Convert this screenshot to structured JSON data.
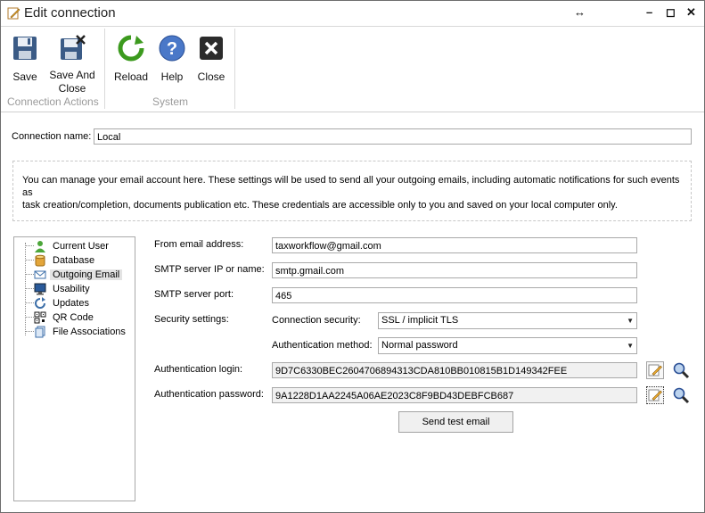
{
  "window": {
    "title": "Edit connection"
  },
  "ribbon": {
    "groups": [
      {
        "label": "Connection Actions",
        "buttons": [
          {
            "label": "Save"
          },
          {
            "label": "Save And Close"
          }
        ]
      },
      {
        "label": "System",
        "buttons": [
          {
            "label": "Reload"
          },
          {
            "label": "Help"
          },
          {
            "label": "Close"
          }
        ]
      }
    ]
  },
  "connection": {
    "name_label": "Connection name:",
    "name_value": "Local"
  },
  "info": {
    "line1": "You can manage your email account here. These settings will be used to send all your outgoing emails, including automatic notifications for such events as",
    "line2": "task creation/completion, documents publication etc. These credentials are accessible only to you and saved on your local computer only."
  },
  "nav": {
    "items": [
      {
        "label": "Current User",
        "icon": "user-icon"
      },
      {
        "label": "Database",
        "icon": "database-icon"
      },
      {
        "label": "Outgoing Email",
        "icon": "envelope-icon",
        "selected": true
      },
      {
        "label": "Usability",
        "icon": "monitor-icon"
      },
      {
        "label": "Updates",
        "icon": "refresh-icon"
      },
      {
        "label": "QR Code",
        "icon": "qr-code-icon"
      },
      {
        "label": "File Associations",
        "icon": "documents-icon"
      }
    ]
  },
  "email": {
    "from_label": "From email address:",
    "from_value": "taxworkflow@gmail.com",
    "smtp_label": "SMTP server IP or name:",
    "smtp_value": "smtp.gmail.com",
    "port_label": "SMTP server port:",
    "port_value": "465",
    "security_label": "Security settings:",
    "conn_security_label": "Connection security:",
    "conn_security_value": "SSL / implicit TLS",
    "auth_method_label": "Authentication method:",
    "auth_method_value": "Normal password",
    "login_label": "Authentication login:",
    "login_value": "9D7C6330BEC2604706894313CDA810BB010815B1D149342FEE",
    "password_label": "Authentication password:",
    "password_value": "9A1228D1AA2245A06AE2023C8F9BD43DEBFCB687",
    "test_button": "Send test email"
  }
}
